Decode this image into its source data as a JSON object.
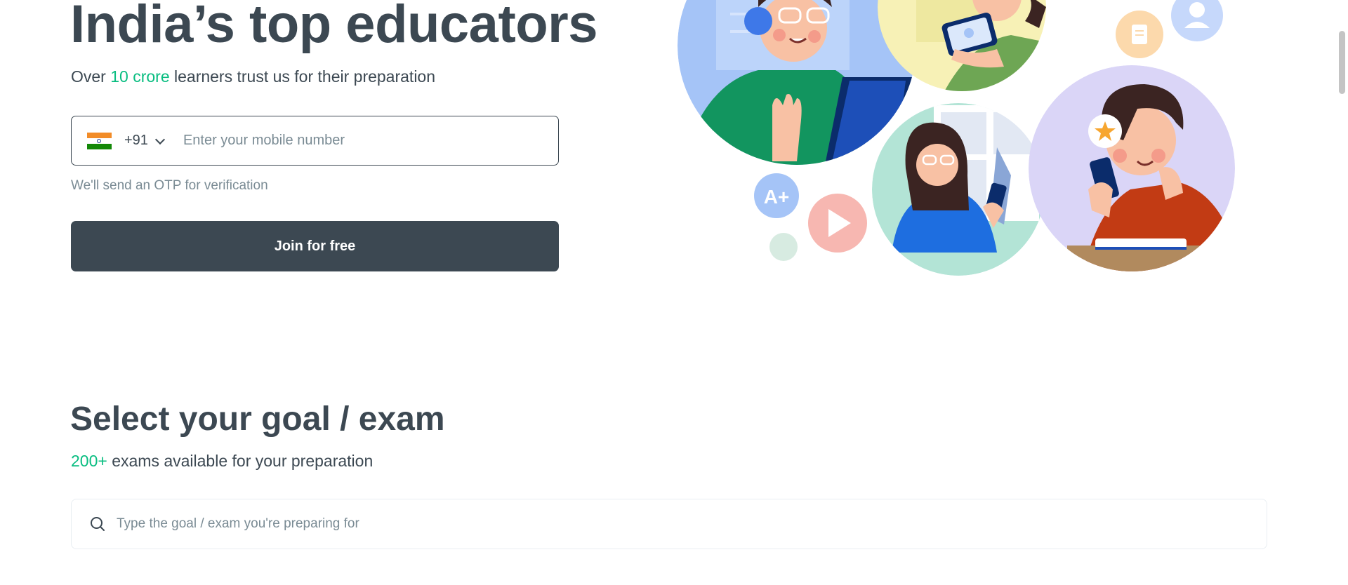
{
  "hero": {
    "title": "India’s top educators",
    "subtitle_prefix": "Over ",
    "subtitle_highlight": "10 crore",
    "subtitle_suffix": " learners trust us for their preparation"
  },
  "phone": {
    "dial_code": "+91",
    "placeholder": "Enter your mobile number",
    "value": "",
    "note": "We'll send an OTP for verification"
  },
  "join_button": {
    "label": "Join for free"
  },
  "goal": {
    "title": "Select your goal / exam",
    "subtitle_highlight": "200+",
    "subtitle_suffix": " exams available for your preparation",
    "search_placeholder": "Type the goal / exam you're preparing for",
    "search_value": ""
  },
  "illustration": {
    "badge_text": "A+"
  },
  "colors": {
    "primary_dark": "#3c4852",
    "accent_green": "#08bd80",
    "muted_text": "#7a8b94"
  }
}
